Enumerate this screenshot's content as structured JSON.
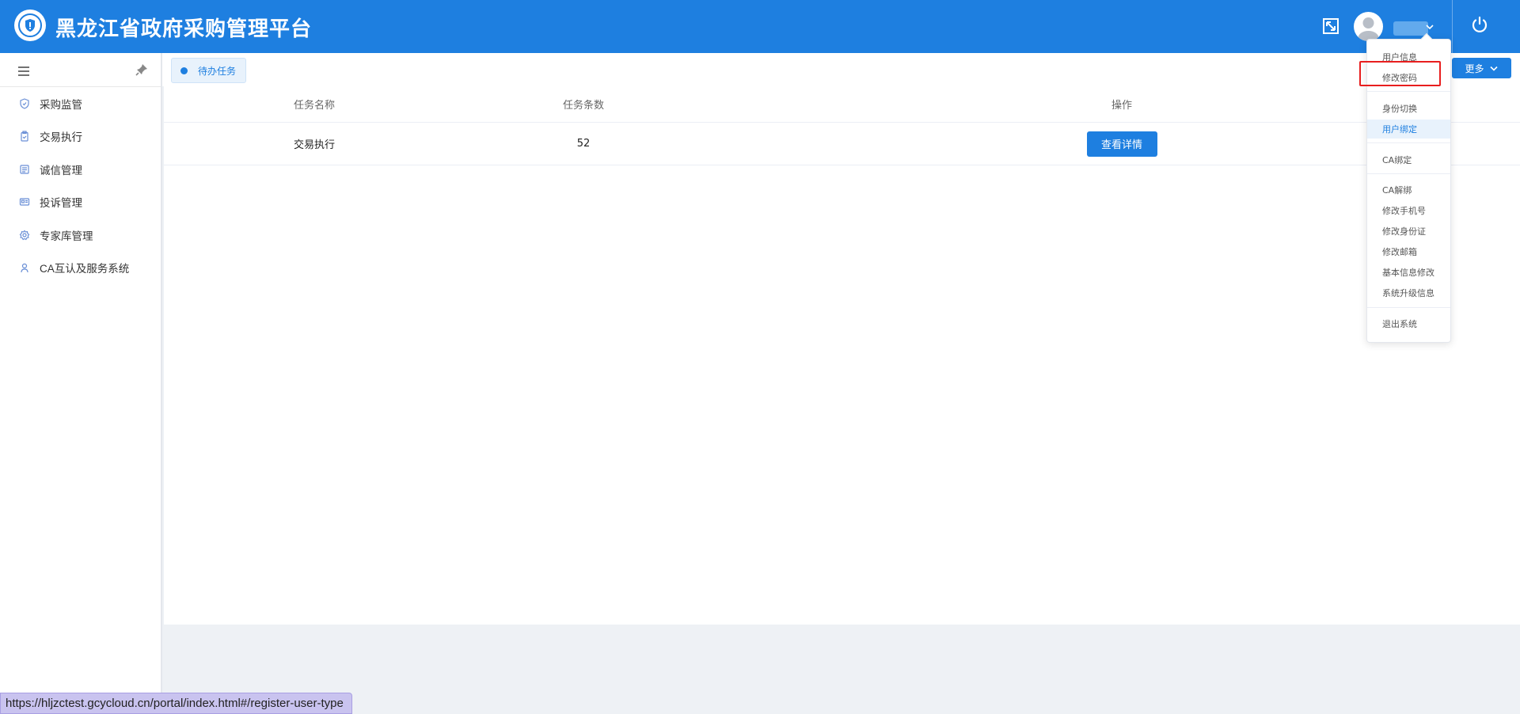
{
  "header": {
    "title": "黑龙江省政府采购管理平台",
    "icons": [
      "logo-emblem",
      "fullscreen-icon",
      "avatar",
      "power-icon"
    ]
  },
  "sidebar": {
    "items": [
      {
        "label": "采购监管",
        "icon": "shield-icon"
      },
      {
        "label": "交易执行",
        "icon": "clipboard-icon"
      },
      {
        "label": "诚信管理",
        "icon": "list-icon"
      },
      {
        "label": "投诉管理",
        "icon": "complaint-icon"
      },
      {
        "label": "专家库管理",
        "icon": "gear-icon"
      },
      {
        "label": "CA互认及服务系统",
        "icon": "person-icon"
      }
    ]
  },
  "tabs": {
    "active": "待办任务",
    "more_label": "更多"
  },
  "table": {
    "headers": [
      "任务名称",
      "任务条数",
      "操作"
    ],
    "rows": [
      {
        "name": "交易执行",
        "count": "52",
        "action": "查看详情"
      }
    ]
  },
  "user_menu": {
    "groups": [
      [
        "用户信息",
        "修改密码"
      ],
      [
        "身份切换",
        "用户绑定"
      ],
      [
        "CA绑定"
      ],
      [
        "CA解绑",
        "修改手机号",
        "修改身份证",
        "修改邮箱",
        "基本信息修改",
        "系统升级信息"
      ],
      [
        "退出系统"
      ]
    ],
    "highlighted": "修改密码",
    "hovered": "用户绑定"
  },
  "status_bar": {
    "url": "https://hljzctest.gcycloud.cn/portal/index.html#/register-user-type"
  },
  "colors": {
    "primary": "#1e7fe0",
    "highlight_border": "#e81e1e",
    "background": "#eef1f5"
  }
}
